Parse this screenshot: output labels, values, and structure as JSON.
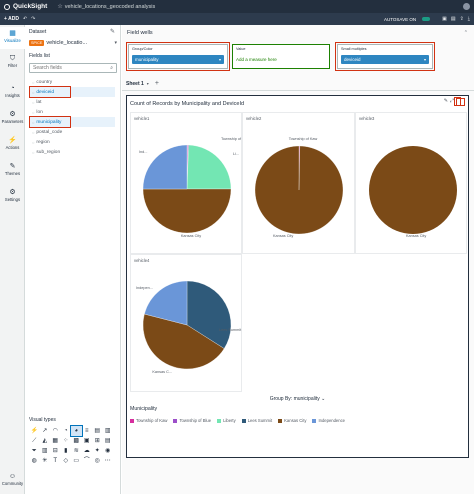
{
  "app": {
    "brand": "QuickSight",
    "analysis_name": "vehicle_locations_geocoded analysis"
  },
  "toolbar": {
    "add_label": "+ ADD",
    "autosave_label": "AUTOSAVE ON"
  },
  "nav": [
    {
      "label": "Visualize",
      "icon": "visualize-icon",
      "glyph": "▦"
    },
    {
      "label": "Filter",
      "icon": "filter-icon",
      "glyph": "⛉"
    },
    {
      "label": "Insights",
      "icon": "insights-icon",
      "glyph": "◔"
    },
    {
      "label": "Parameters",
      "icon": "parameters-icon",
      "glyph": "⚙"
    },
    {
      "label": "Actions",
      "icon": "actions-icon",
      "glyph": "⚡"
    },
    {
      "label": "Themes",
      "icon": "themes-icon",
      "glyph": "✎"
    },
    {
      "label": "Settings",
      "icon": "settings-icon",
      "glyph": "⚙"
    },
    {
      "label": "Community",
      "icon": "community-icon",
      "glyph": "☺"
    }
  ],
  "panel": {
    "dataset_header": "Dataset",
    "dataset_badge": "SPICE",
    "dataset_name": "vehicle_locatio...",
    "fields_header": "Fields list",
    "search_placeholder": "Search fields",
    "fields": [
      {
        "name": "country",
        "selected": false
      },
      {
        "name": "deviceid",
        "selected": true
      },
      {
        "name": "lat",
        "selected": false
      },
      {
        "name": "lon",
        "selected": false
      },
      {
        "name": "municipality",
        "selected": true
      },
      {
        "name": "postal_code",
        "selected": false
      },
      {
        "name": "region",
        "selected": false
      },
      {
        "name": "sub_region",
        "selected": false
      }
    ],
    "visual_types_header": "Visual types"
  },
  "field_wells": {
    "title": "Field wells",
    "group_color_label": "Group/Color",
    "group_color_value": "municipality",
    "value_label": "Value",
    "value_add": "Add a measure here",
    "small_multiples_label": "Small multiples",
    "small_multiples_value": "deviceid"
  },
  "sheet": {
    "tab_label": "Sheet 1"
  },
  "visual": {
    "title": "Count of Records by Municipality and DeviceId",
    "group_by_label": "Group By: municipality",
    "legend_title": "Municipality"
  },
  "colors": {
    "Township of Kaw": "#d62e9e",
    "Township of Blue": "#9c4fc9",
    "Liberty": "#73e6b3",
    "Lees Summit": "#2f5a7a",
    "Kansas City": "#7b4a17",
    "Independence": "#6a96d8"
  },
  "chart_data": {
    "type": "pie",
    "title": "Count of Records by Municipality and DeviceId",
    "legend": [
      "Township of Kaw",
      "Township of Blue",
      "Liberty",
      "Lees Summit",
      "Kansas City",
      "Independence"
    ],
    "legend_placement": "bottom",
    "small_multiples": [
      {
        "name": "vehicle1",
        "slices": [
          {
            "label": "Township of Kaw",
            "value": 0.3
          },
          {
            "label": "Township of Blue",
            "value": 0.3
          },
          {
            "label": "Liberty",
            "value": 24.4
          },
          {
            "label": "Kansas City",
            "value": 50
          },
          {
            "label": "Independence",
            "value": 25
          }
        ],
        "labels_shown": [
          "Township of Blue",
          "Li...",
          "Kansas City",
          "Ind..."
        ]
      },
      {
        "name": "vehicle2",
        "slices": [
          {
            "label": "Township of Kaw",
            "value": 0.3
          },
          {
            "label": "Kansas City",
            "value": 99.7
          }
        ],
        "labels_shown": [
          "Township of Kaw",
          "Kansas City"
        ]
      },
      {
        "name": "vehicle3",
        "slices": [
          {
            "label": "Kansas City",
            "value": 100
          }
        ],
        "labels_shown": [
          "Kansas City"
        ]
      },
      {
        "name": "vehicle4",
        "slices": [
          {
            "label": "Lees Summit",
            "value": 34
          },
          {
            "label": "Kansas City",
            "value": 45
          },
          {
            "label": "Independence",
            "value": 21
          }
        ],
        "labels_shown": [
          "Lees Summit",
          "Kansas C...",
          "Indepen..."
        ]
      }
    ]
  }
}
